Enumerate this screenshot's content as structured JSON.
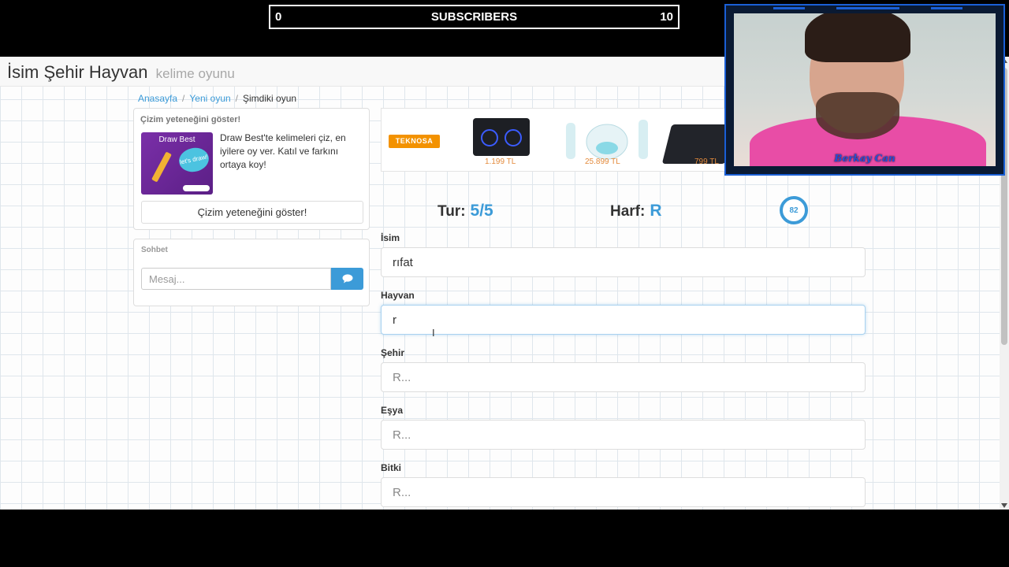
{
  "overlay": {
    "subscribers": {
      "current": "0",
      "label": "SUBSCRIBERS",
      "goal": "10"
    },
    "webcam": {
      "name": "Berkay Can"
    }
  },
  "site": {
    "brand": "İsim Şehir Hayvan",
    "brand_sub": "kelime oyunu"
  },
  "breadcrumb": [
    {
      "label": "Anasayfa"
    },
    {
      "label": "Yeni oyun"
    },
    {
      "label": "Şimdiki oyun"
    }
  ],
  "draw_panel": {
    "title": "Çizim yeteneğini göster!",
    "thumb_title": "Draw Best",
    "thumb_bubble": "let's draw!",
    "description": "Draw Best'te kelimeleri çiz, en iyilere oy ver. Katıl ve farkını ortaya koy!",
    "button_label": "Çizim yeteneğini göster!"
  },
  "chat_panel": {
    "title": "Sohbet",
    "placeholder": "Mesaj..."
  },
  "ad": {
    "brand": "TEKNOSA",
    "prices": [
      "1.199 TL",
      "25.899 TL",
      "799 TL"
    ]
  },
  "game": {
    "round_label": "Tur:",
    "round_value": "5/5",
    "letter_label": "Harf:",
    "letter_value": "R",
    "timer": "82",
    "fields": [
      {
        "label": "İsim",
        "value": "rıfat",
        "placeholder": "R..."
      },
      {
        "label": "Hayvan",
        "value": "r",
        "placeholder": "R..."
      },
      {
        "label": "Şehir",
        "value": "",
        "placeholder": "R..."
      },
      {
        "label": "Eşya",
        "value": "",
        "placeholder": "R..."
      },
      {
        "label": "Bitki",
        "value": "",
        "placeholder": "R..."
      }
    ]
  },
  "colors": {
    "accent": "#3c9bd8",
    "ad_price": "#e38a3b",
    "webcam_frame": "#1a5fd6",
    "brand_orange": "#f39200"
  }
}
